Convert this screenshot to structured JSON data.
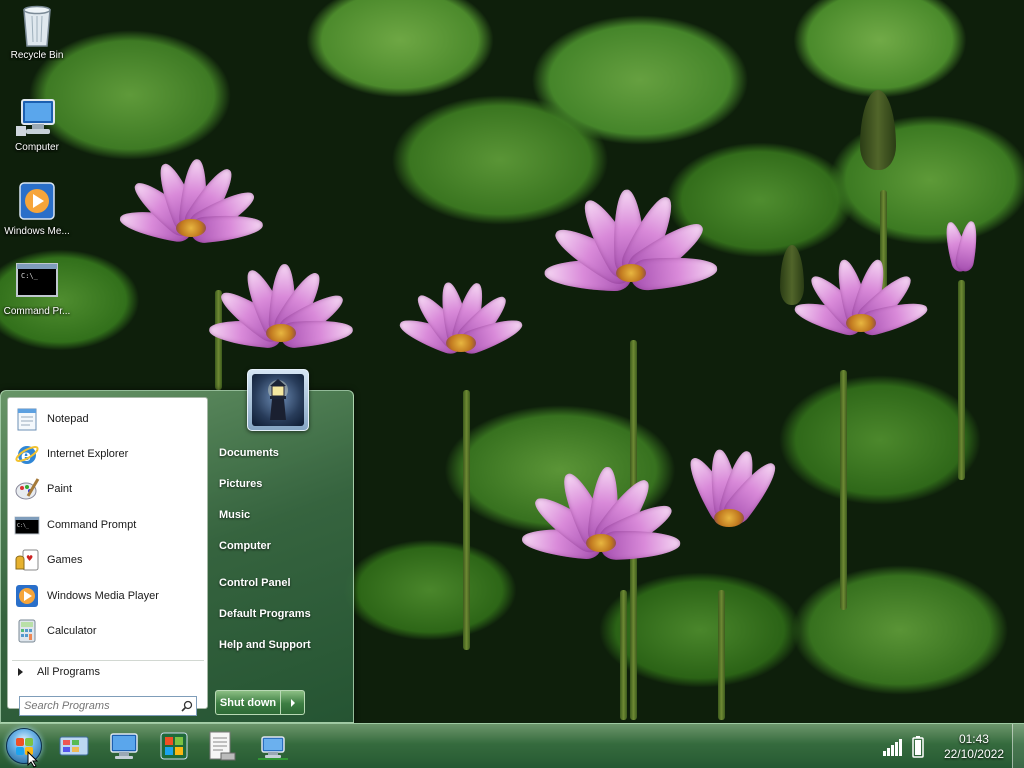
{
  "desktop": {
    "icons": [
      {
        "label": "Recycle Bin",
        "icon": "recycle-bin-icon"
      },
      {
        "label": "Computer",
        "icon": "computer-icon"
      },
      {
        "label": "Windows Me...",
        "icon": "windows-media-player-icon"
      },
      {
        "label": "Command Pr...",
        "icon": "command-prompt-icon"
      }
    ]
  },
  "start_menu": {
    "programs": [
      {
        "label": "Notepad",
        "icon": "notepad-icon"
      },
      {
        "label": "Internet Explorer",
        "icon": "internet-explorer-icon"
      },
      {
        "label": "Paint",
        "icon": "paint-icon"
      },
      {
        "label": "Command Prompt",
        "icon": "command-prompt-icon"
      },
      {
        "label": "Games",
        "icon": "games-icon"
      },
      {
        "label": "Windows Media Player",
        "icon": "windows-media-player-icon"
      },
      {
        "label": "Calculator",
        "icon": "calculator-icon"
      }
    ],
    "all_programs": "All Programs",
    "search_placeholder": "Search Programs",
    "right_items": [
      "Documents",
      "Pictures",
      "Music",
      "Computer",
      "Control Panel",
      "Default Programs",
      "Help and Support"
    ],
    "shutdown_label": "Shut down"
  },
  "taskbar": {
    "pinned": [
      "control-panel-icon",
      "computer-icon",
      "media-center-icon",
      "document-icon",
      "network-icon"
    ],
    "clock_time": "01:43",
    "clock_date": "22/10/2022",
    "tray_icons": [
      "signal-strength-icon",
      "battery-icon"
    ]
  },
  "colors": {
    "accent_green": "#3c7d42",
    "start_orb_blue": "#1b5b8f"
  }
}
